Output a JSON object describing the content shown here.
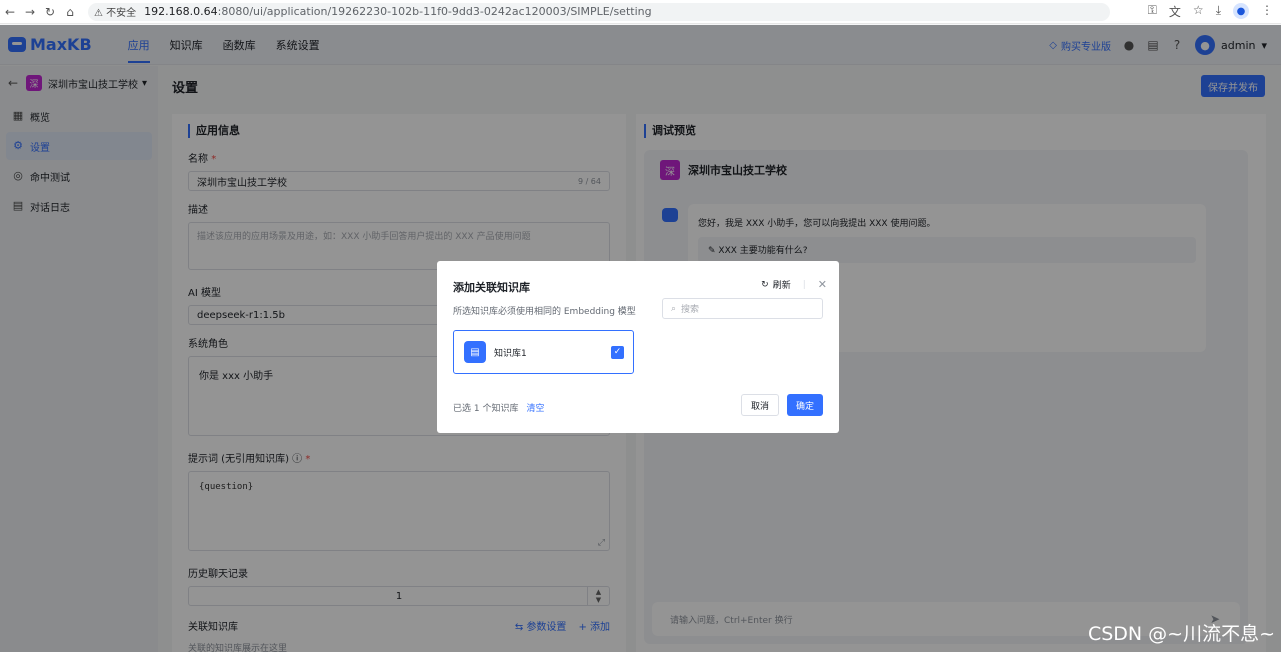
{
  "browser": {
    "insecure_label": "不安全",
    "url_host": "192.168.0.64",
    "url_path": ":8080/ui/application/19262230-102b-11f0-9dd3-0242ac120003/SIMPLE/setting"
  },
  "header": {
    "logo_text": "MaxKB",
    "nav": [
      "应用",
      "知识库",
      "函数库",
      "系统设置"
    ],
    "buy_label": "购买专业版",
    "user_name": "admin"
  },
  "sidebar": {
    "app_name": "深圳市宝山技工学校",
    "app_initial": "深",
    "items": [
      "概览",
      "设置",
      "命中测试",
      "对话日志"
    ]
  },
  "main": {
    "page_title": "设置",
    "publish_label": "保存并发布"
  },
  "form": {
    "section_title": "应用信息",
    "name_label": "名称",
    "name_value": "深圳市宝山技工学校",
    "name_counter": "9 / 64",
    "desc_label": "描述",
    "desc_placeholder": "描述该应用的应用场景及用途，如：XXX 小助手回答用户提出的 XXX 产品使用问题",
    "model_label": "AI 模型",
    "model_value": "deepseek-r1:1.5b",
    "role_label": "系统角色",
    "role_value": "你是 xxx 小助手",
    "prompt_label": "提示词 (无引用知识库)",
    "prompt_value": "{question}",
    "history_label": "历史聊天记录",
    "history_value": "1",
    "kb_label": "关联知识库",
    "kb_param_link": "参数设置",
    "kb_add_link": "+ 添加",
    "kb_hint": "关联的知识库展示在这里"
  },
  "preview": {
    "section_title": "调试预览",
    "app_name": "深圳市宝山技工学校",
    "app_initial": "深",
    "greeting": "您好，我是 XXX 小助手，您可以向我提出 XXX 使用问题。",
    "suggested_question": "XXX 主要功能有什么?",
    "input_placeholder": "请输入问题，Ctrl+Enter 换行"
  },
  "modal": {
    "title": "添加关联知识库",
    "refresh_label": "刷新",
    "subtitle": "所选知识库必须使用相同的 Embedding 模型",
    "search_placeholder": "搜索",
    "kb_item_name": "知识库1",
    "selected_text": "已选 1 个知识库",
    "clear_label": "清空",
    "cancel_label": "取消",
    "confirm_label": "确定"
  },
  "watermark": "CSDN @~川流不息~",
  "colors": {
    "accent": "#3370ff",
    "app_badge": "#c026d3"
  }
}
